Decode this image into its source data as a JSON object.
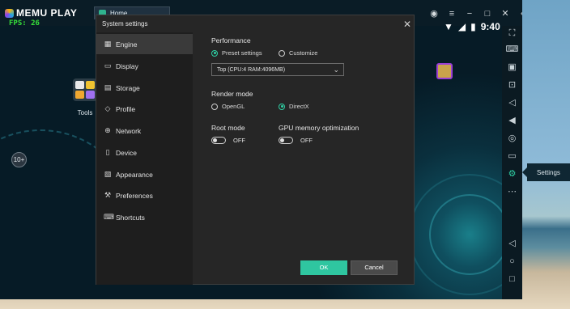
{
  "app": {
    "logo_text": "MEMU PLAY",
    "fps_text": "FPS: 26",
    "home_tab": "Home",
    "clock": "9:40",
    "tools_label": "Tools",
    "badge_value": "10+",
    "settings_tooltip": "Settings"
  },
  "dialog": {
    "title": "System settings",
    "close_label": "✕",
    "sidebar": [
      {
        "label": "Engine",
        "icon": "chip-icon",
        "active": true
      },
      {
        "label": "Display",
        "icon": "monitor-icon"
      },
      {
        "label": "Storage",
        "icon": "storage-icon"
      },
      {
        "label": "Profile",
        "icon": "tag-icon"
      },
      {
        "label": "Network",
        "icon": "globe-icon"
      },
      {
        "label": "Device",
        "icon": "phone-icon"
      },
      {
        "label": "Appearance",
        "icon": "palette-icon"
      },
      {
        "label": "Preferences",
        "icon": "wrench-icon"
      },
      {
        "label": "Shortcuts",
        "icon": "keyboard-icon"
      }
    ],
    "performance": {
      "heading": "Performance",
      "options": [
        "Preset settings",
        "Customize"
      ],
      "selected": "Preset settings",
      "preset_value": "Top (CPU:4 RAM:4096MB)"
    },
    "render_mode": {
      "heading": "Render mode",
      "options": [
        "OpenGL",
        "DirectX"
      ],
      "selected": "DirectX"
    },
    "root_mode": {
      "heading": "Root mode",
      "state": "OFF"
    },
    "gpu_memory": {
      "heading": "GPU memory optimization",
      "state": "OFF"
    },
    "ok_label": "OK",
    "cancel_label": "Cancel"
  },
  "colors": {
    "accent": "#2fd1a5",
    "ok_button": "#2fc6a0",
    "fps_text": "#36e03a"
  }
}
